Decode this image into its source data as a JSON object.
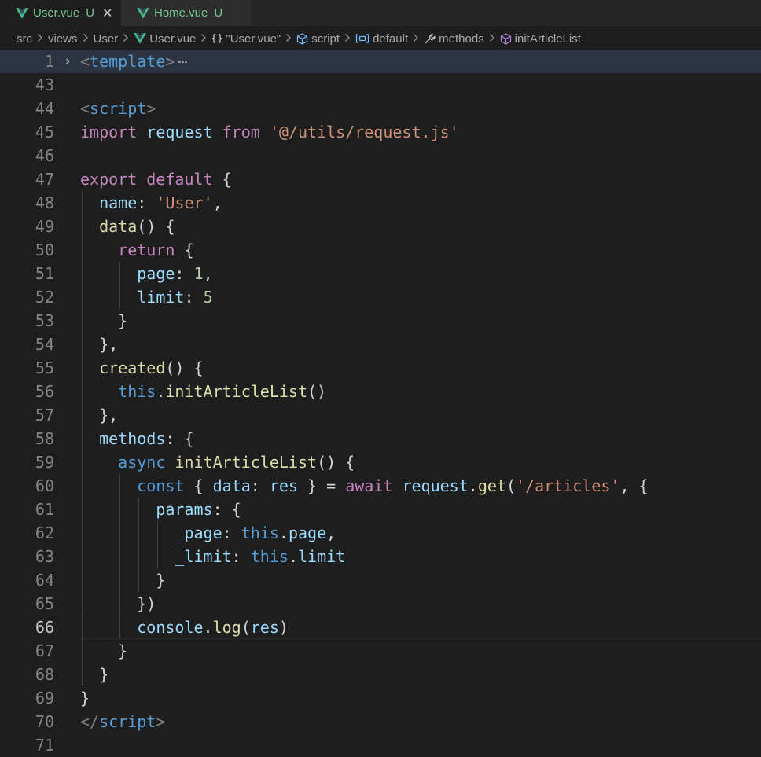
{
  "tabs": [
    {
      "name": "User.vue",
      "status": "U",
      "close": "✕"
    },
    {
      "name": "Home.vue",
      "status": "U"
    }
  ],
  "breadcrumb": [
    {
      "label": "src",
      "icon": ""
    },
    {
      "label": "views",
      "icon": ""
    },
    {
      "label": "User",
      "icon": ""
    },
    {
      "label": "User.vue",
      "icon": "vue-icon"
    },
    {
      "label": "\"User.vue\"",
      "icon": "braces-icon"
    },
    {
      "label": "script",
      "icon": "cube-icon"
    },
    {
      "label": "default",
      "icon": "variable-icon"
    },
    {
      "label": "methods",
      "icon": "wrench-icon"
    },
    {
      "label": "initArticleList",
      "icon": "method-cube-icon"
    }
  ],
  "colors": {
    "vue_green": "#41b883",
    "vue_dark": "#35495e",
    "modified": "#73c991",
    "keyword": "#c586c0",
    "string": "#ce9178",
    "property": "#9cdcfe",
    "function": "#dcdcaa",
    "tag": "#569cd6",
    "number": "#b5cea8"
  },
  "editor": {
    "current_line": 66,
    "folded_line": 1,
    "fold_glyph": "›",
    "lines": [
      {
        "n": "1",
        "indent": 0,
        "tokens": [
          [
            "tag",
            "<"
          ],
          [
            "tn",
            "template"
          ],
          [
            "tag",
            ">"
          ],
          [
            "ellipsis",
            "⋯"
          ]
        ]
      },
      {
        "n": "43",
        "indent": 0,
        "tokens": []
      },
      {
        "n": "44",
        "indent": 0,
        "tokens": [
          [
            "tag",
            "<"
          ],
          [
            "tn",
            "script"
          ],
          [
            "tag",
            ">"
          ]
        ]
      },
      {
        "n": "45",
        "indent": 0,
        "tokens": [
          [
            "kw",
            "import"
          ],
          [
            "pl",
            " "
          ],
          [
            "pr",
            "request"
          ],
          [
            "pl",
            " "
          ],
          [
            "kw",
            "from"
          ],
          [
            "pl",
            " "
          ],
          [
            "st",
            "'@/utils/request.js'"
          ]
        ]
      },
      {
        "n": "46",
        "indent": 0,
        "tokens": []
      },
      {
        "n": "47",
        "indent": 0,
        "tokens": [
          [
            "kw",
            "export"
          ],
          [
            "pl",
            " "
          ],
          [
            "kw",
            "default"
          ],
          [
            "pl",
            " {"
          ]
        ]
      },
      {
        "n": "48",
        "indent": 1,
        "tokens": [
          [
            "pr",
            "name"
          ],
          [
            "pl",
            ": "
          ],
          [
            "st",
            "'User'"
          ],
          [
            "pl",
            ","
          ]
        ]
      },
      {
        "n": "49",
        "indent": 1,
        "tokens": [
          [
            "fn",
            "data"
          ],
          [
            "pl",
            "() {"
          ]
        ]
      },
      {
        "n": "50",
        "indent": 2,
        "tokens": [
          [
            "kw",
            "return"
          ],
          [
            "pl",
            " {"
          ]
        ]
      },
      {
        "n": "51",
        "indent": 3,
        "tokens": [
          [
            "pr",
            "page"
          ],
          [
            "pl",
            ": "
          ],
          [
            "nm",
            "1"
          ],
          [
            "pl",
            ","
          ]
        ]
      },
      {
        "n": "52",
        "indent": 3,
        "tokens": [
          [
            "pr",
            "limit"
          ],
          [
            "pl",
            ": "
          ],
          [
            "nm",
            "5"
          ]
        ]
      },
      {
        "n": "53",
        "indent": 2,
        "tokens": [
          [
            "pl",
            "}"
          ]
        ]
      },
      {
        "n": "54",
        "indent": 1,
        "tokens": [
          [
            "pl",
            "},"
          ]
        ]
      },
      {
        "n": "55",
        "indent": 1,
        "tokens": [
          [
            "fn",
            "created"
          ],
          [
            "pl",
            "() {"
          ]
        ]
      },
      {
        "n": "56",
        "indent": 2,
        "tokens": [
          [
            "th",
            "this"
          ],
          [
            "pl",
            "."
          ],
          [
            "fn",
            "initArticleList"
          ],
          [
            "pl",
            "()"
          ]
        ]
      },
      {
        "n": "57",
        "indent": 1,
        "tokens": [
          [
            "pl",
            "},"
          ]
        ]
      },
      {
        "n": "58",
        "indent": 1,
        "tokens": [
          [
            "pr",
            "methods"
          ],
          [
            "pl",
            ": {"
          ]
        ]
      },
      {
        "n": "59",
        "indent": 2,
        "tokens": [
          [
            "th",
            "async"
          ],
          [
            "pl",
            " "
          ],
          [
            "fn",
            "initArticleList"
          ],
          [
            "pl",
            "() {"
          ]
        ]
      },
      {
        "n": "60",
        "indent": 3,
        "tokens": [
          [
            "th",
            "const"
          ],
          [
            "pl",
            " { "
          ],
          [
            "pr",
            "data"
          ],
          [
            "pl",
            ": "
          ],
          [
            "pr",
            "res"
          ],
          [
            "pl",
            " } = "
          ],
          [
            "kw",
            "await"
          ],
          [
            "pl",
            " "
          ],
          [
            "pr",
            "request"
          ],
          [
            "pl",
            "."
          ],
          [
            "fn",
            "get"
          ],
          [
            "pl",
            "("
          ],
          [
            "st",
            "'/articles'"
          ],
          [
            "pl",
            ", {"
          ]
        ]
      },
      {
        "n": "61",
        "indent": 4,
        "tokens": [
          [
            "pr",
            "params"
          ],
          [
            "pl",
            ": {"
          ]
        ]
      },
      {
        "n": "62",
        "indent": 5,
        "tokens": [
          [
            "pr",
            "_page"
          ],
          [
            "pl",
            ": "
          ],
          [
            "th",
            "this"
          ],
          [
            "pl",
            "."
          ],
          [
            "pr",
            "page"
          ],
          [
            "pl",
            ","
          ]
        ]
      },
      {
        "n": "63",
        "indent": 5,
        "tokens": [
          [
            "pr",
            "_limit"
          ],
          [
            "pl",
            ": "
          ],
          [
            "th",
            "this"
          ],
          [
            "pl",
            "."
          ],
          [
            "pr",
            "limit"
          ]
        ]
      },
      {
        "n": "64",
        "indent": 4,
        "tokens": [
          [
            "pl",
            "}"
          ]
        ]
      },
      {
        "n": "65",
        "indent": 3,
        "tokens": [
          [
            "pl",
            "})"
          ]
        ]
      },
      {
        "n": "66",
        "indent": 3,
        "tokens": [
          [
            "pr",
            "console"
          ],
          [
            "pl",
            "."
          ],
          [
            "fn",
            "log"
          ],
          [
            "pl",
            "("
          ],
          [
            "pr",
            "res"
          ],
          [
            "pl",
            ")"
          ]
        ]
      },
      {
        "n": "67",
        "indent": 2,
        "tokens": [
          [
            "pl",
            "}"
          ]
        ]
      },
      {
        "n": "68",
        "indent": 1,
        "tokens": [
          [
            "pl",
            "}"
          ]
        ]
      },
      {
        "n": "69",
        "indent": 0,
        "tokens": [
          [
            "pl",
            "}"
          ]
        ]
      },
      {
        "n": "70",
        "indent": 0,
        "tokens": [
          [
            "tag",
            "</"
          ],
          [
            "tn",
            "script"
          ],
          [
            "tag",
            ">"
          ]
        ]
      },
      {
        "n": "71",
        "indent": 0,
        "tokens": []
      }
    ]
  }
}
